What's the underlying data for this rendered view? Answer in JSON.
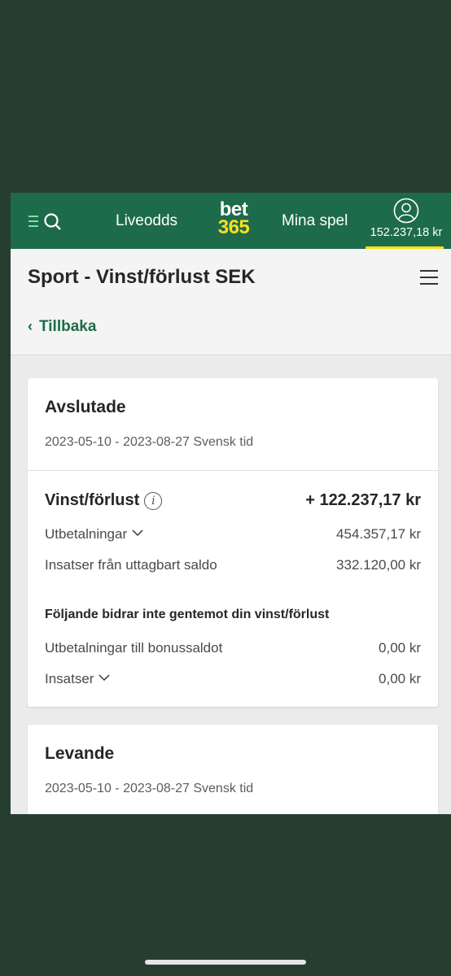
{
  "header": {
    "nav_live": "Liveodds",
    "logo_top": "bet",
    "logo_bottom": "365",
    "nav_mine": "Mina spel",
    "balance": "152.237,18 kr"
  },
  "page": {
    "title": "Sport - Vinst/förlust SEK",
    "back_label": "Tillbaka"
  },
  "settled": {
    "title": "Avslutade",
    "date_range": "2023-05-10 - 2023-08-27 Svensk tid",
    "profit_label": "Vinst/förlust",
    "profit_value": "+ 122.237,17 kr",
    "payouts_label": "Utbetalningar",
    "payouts_value": "454.357,17 kr",
    "stakes_label": "Insatser från uttagbart saldo",
    "stakes_value": "332.120,00 kr",
    "note": "Följande bidrar inte gentemot din vinst/förlust",
    "bonus_payouts_label": "Utbetalningar till bonussaldot",
    "bonus_payouts_value": "0,00 kr",
    "bonus_stakes_label": "Insatser",
    "bonus_stakes_value": "0,00 kr"
  },
  "live": {
    "title": "Levande",
    "date_range": "2023-05-10 - 2023-08-27 Svensk tid"
  },
  "colors": {
    "brand_green": "#1d6b4a",
    "brand_yellow": "#ffdf1b",
    "backdrop": "#263e30"
  }
}
